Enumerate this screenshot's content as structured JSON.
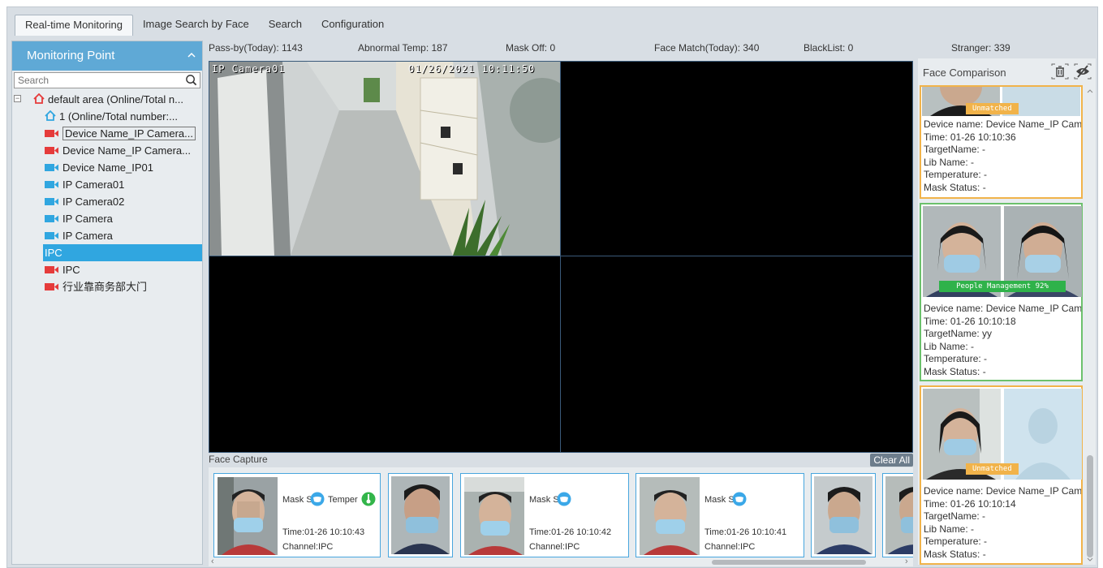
{
  "tabs": [
    {
      "label": "Real-time Monitoring",
      "active": true
    },
    {
      "label": "Image Search by Face"
    },
    {
      "label": "Search"
    },
    {
      "label": "Configuration"
    }
  ],
  "sidebar": {
    "title": "Monitoring Point",
    "search_placeholder": "Search",
    "tree": [
      {
        "label": "default area (Online/Total n...",
        "icon": "home-icon",
        "color": "#e53b3b"
      },
      {
        "label": "1 (Online/Total number:...",
        "icon": "home-icon",
        "color": "#30a6e0"
      },
      {
        "label": "Device Name_IP Camera...",
        "icon": "camera-icon",
        "color": "#e53b3b"
      },
      {
        "label": "Device Name_IP Camera...",
        "icon": "camera-icon",
        "color": "#e53b3b"
      },
      {
        "label": "Device Name_IP01",
        "icon": "camera-icon",
        "color": "#30a6e0"
      },
      {
        "label": "IP Camera01",
        "icon": "camera-icon",
        "color": "#30a6e0"
      },
      {
        "label": "IP Camera02",
        "icon": "camera-icon",
        "color": "#30a6e0"
      },
      {
        "label": "IP Camera",
        "icon": "camera-icon",
        "color": "#30a6e0"
      },
      {
        "label": "IP Camera",
        "icon": "camera-icon",
        "color": "#30a6e0"
      },
      {
        "label": "IPC",
        "icon": "camera-icon",
        "color": "#30a6e0",
        "selected": true
      },
      {
        "label": "IPC",
        "icon": "camera-icon",
        "color": "#e53b3b"
      },
      {
        "label": "行业靠商务部大门",
        "icon": "camera-icon",
        "color": "#e53b3b"
      }
    ]
  },
  "stats": {
    "passby": "Pass-by(Today): 1143",
    "abnormal_temp": "Abnormal Temp: 187",
    "mask_off": "Mask Off: 0",
    "face_match": "Face Match(Today): 340",
    "blacklist": "BlackList: 0",
    "stranger": "Stranger: 339"
  },
  "video": {
    "camera_name": "IP Camera01",
    "timestamp": "01/26/2021 10:11:50"
  },
  "face_capture": {
    "title": "Face Capture",
    "clear_label": "Clear All",
    "items": [
      {
        "mask_label": "Mask St",
        "temp_label": "Temper",
        "time": "Time:01-26 10:10:43",
        "channel": "Channel:IPC"
      },
      {
        "mask_label": "Mask St",
        "time": "Time:01-26 10:10:42",
        "channel": "Channel:IPC"
      },
      {
        "mask_label": "Mask St",
        "time": "Time:01-26 10:10:41",
        "channel": "Channel:IPC"
      }
    ]
  },
  "face_comparison": {
    "title": "Face Comparison",
    "cards": [
      {
        "border": "#f1b34a",
        "tag": "Unmatched",
        "tag_color": "#f1b34a",
        "device": "Device name: Device Name_IP Camer",
        "time": "Time: 01-26 10:10:36",
        "target": "TargetName: -",
        "lib": "Lib Name: -",
        "temp": "Temperature: -",
        "mask": "Mask Status: -"
      },
      {
        "border": "#6cc16c",
        "tag": "People Management 92%",
        "tag_color": "#2fb24a",
        "device": "Device name: Device Name_IP Camer",
        "time": "Time: 01-26 10:10:18",
        "target": "TargetName: yy",
        "lib": "Lib Name: -",
        "temp": "Temperature: -",
        "mask": "Mask Status: -"
      },
      {
        "border": "#f1b34a",
        "tag": "Unmatched",
        "tag_color": "#f1b34a",
        "device": "Device name: Device Name_IP Camer",
        "time": "Time: 01-26 10:10:14",
        "target": "TargetName: -",
        "lib": "Lib Name: -",
        "temp": "Temperature: -",
        "mask": "Mask Status: -"
      }
    ]
  }
}
